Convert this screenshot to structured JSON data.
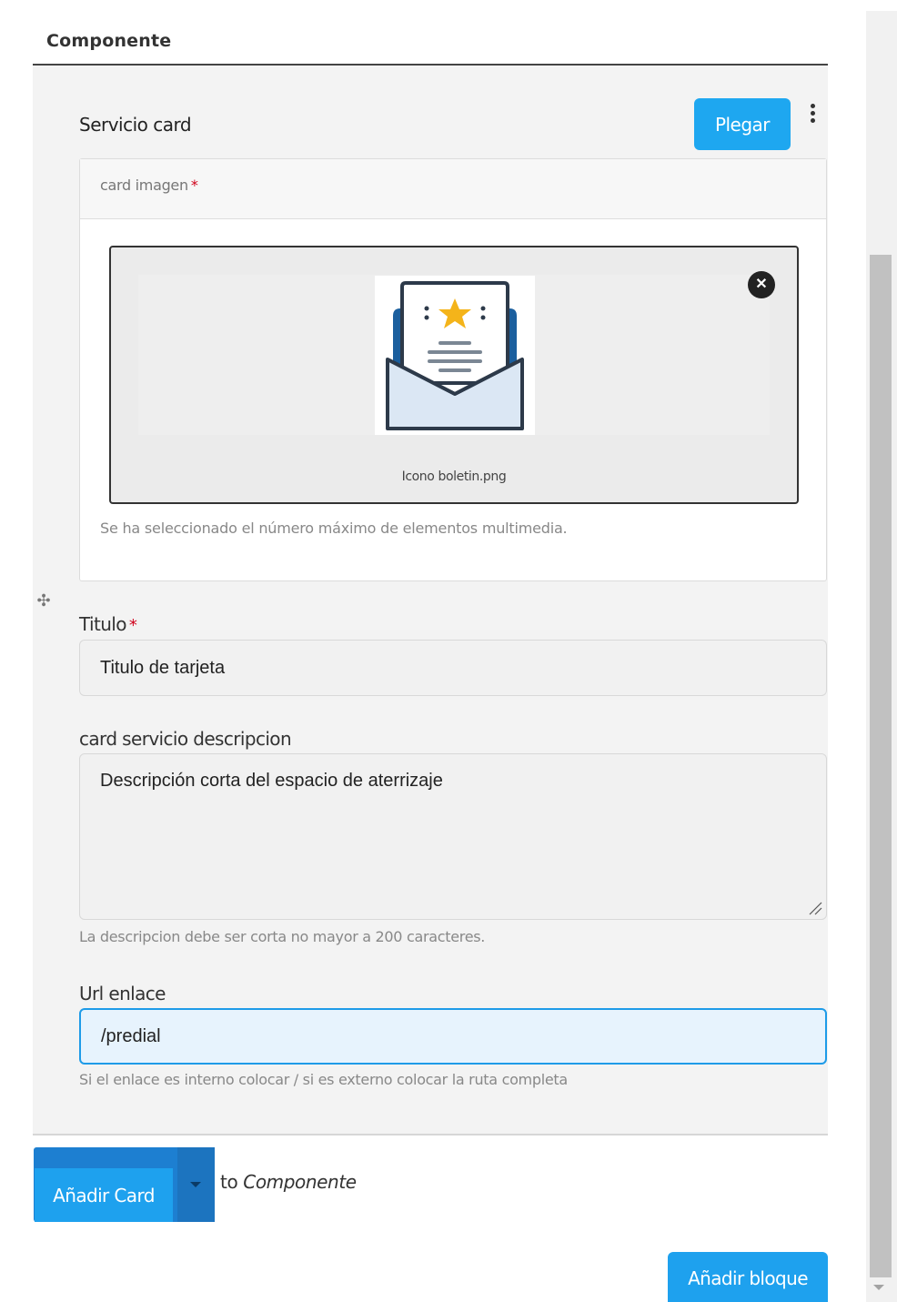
{
  "header": {
    "title": "Componente"
  },
  "item": {
    "title": "Servicio card",
    "collapse_label": "Plegar"
  },
  "media": {
    "label": "card imagen",
    "required_mark": "*",
    "filename": "Icono boletin.png",
    "thumbnail_icon": "newsletter-envelope-star-icon",
    "note": "Se ha seleccionado el número máximo de elementos multimedia."
  },
  "fields": {
    "titulo": {
      "label": "Titulo",
      "required_mark": "*",
      "value": "Titulo de tarjeta"
    },
    "descripcion": {
      "label": "card servicio descripcion",
      "value": "Descripción corta del espacio de aterrizaje",
      "help": "La descripcion debe ser corta no mayor a 200 caracteres."
    },
    "url": {
      "label": "Url enlace",
      "value": "/predial",
      "help": "Si el enlace es interno colocar / si es externo colocar la ruta completa"
    }
  },
  "footer": {
    "add_card_label": "Añadir Card",
    "to_prefix": "to",
    "to_target": "Componente",
    "add_block_label": "Añadir bloque"
  },
  "colors": {
    "primary": "#1ea1ee",
    "primary_dark": "#1d7fd1",
    "required": "#d0021b",
    "focus_border": "#1e9be8"
  }
}
